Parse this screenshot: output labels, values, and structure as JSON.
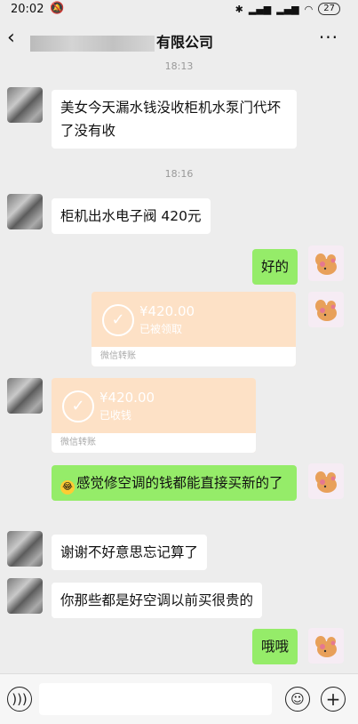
{
  "status": {
    "time": "20:02",
    "battery": "27"
  },
  "header": {
    "title_suffix": "有限公司"
  },
  "timestamps": [
    "18:13",
    "18:16"
  ],
  "messages": {
    "m1": "美女今天漏水钱没收柜机水泵门代坏了没有收",
    "m2": "柜机出水电子阀 420元",
    "m3": "好的",
    "m4": "感觉修空调的钱都能直接买新的了",
    "m5": "谢谢不好意思忘记算了",
    "m6": "你那些都是好空调以前买很贵的",
    "m7": "哦哦"
  },
  "transfers": {
    "t1": {
      "amount": "¥420.00",
      "status": "已被领取",
      "label": "微信转账"
    },
    "t2": {
      "amount": "¥420.00",
      "status": "已收钱",
      "label": "微信转账"
    }
  },
  "colors": {
    "bubble_self": "#95ec69",
    "bubble_other": "#ffffff",
    "transfer": "#fde1c6"
  }
}
